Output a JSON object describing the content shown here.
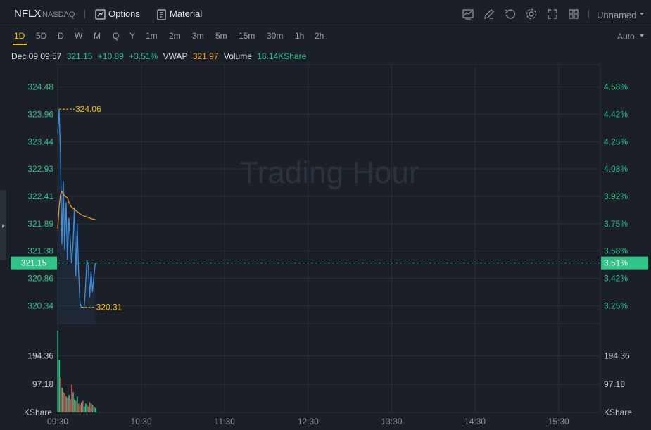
{
  "toolbar": {
    "ticker": "NFLX",
    "exchange": "NASDAQ",
    "options_label": "Options",
    "material_label": "Material",
    "layout_name": "Unnamed",
    "icons": [
      "indicator-icon",
      "draw-icon",
      "undo-icon",
      "settings-icon",
      "fullscreen-icon",
      "layout-grid-icon"
    ]
  },
  "periods": {
    "items": [
      "1D",
      "5D",
      "D",
      "W",
      "M",
      "Q",
      "Y",
      "1m",
      "2m",
      "3m",
      "5m",
      "15m",
      "30m",
      "1h",
      "2h"
    ],
    "active": "1D",
    "scale_mode": "Auto"
  },
  "quote": {
    "datetime": "Dec 09 09:57",
    "price": "321.15",
    "change": "+10.89",
    "change_pct": "+3.51%",
    "vwap_label": "VWAP",
    "vwap": "321.97",
    "volume_label": "Volume",
    "volume": "18.14KShare"
  },
  "colors": {
    "up": "#2fc587",
    "down": "#e0524c",
    "price_line": "#3f8fe0",
    "vwap_line": "#f19e2c",
    "highlight": "#f5c400",
    "watermark": "#2c323c"
  },
  "chart_data": {
    "type": "line",
    "watermark": "Trading Hour",
    "price_ticks": [
      "324.48",
      "323.96",
      "323.44",
      "322.93",
      "322.41",
      "321.89",
      "321.38",
      "320.86",
      "320.34"
    ],
    "pct_ticks": [
      "4.58%",
      "4.42%",
      "4.25%",
      "4.08%",
      "3.92%",
      "3.75%",
      "3.58%",
      "3.42%",
      "3.25%"
    ],
    "current_price_tag": "321.15",
    "current_pct_tag": "3.51%",
    "high_label": "324.06",
    "low_label": "320.31",
    "x_ticks": [
      "09:30",
      "10:30",
      "11:30",
      "12:30",
      "13:30",
      "14:30",
      "15:30"
    ],
    "ylim": [
      320.0,
      324.9
    ],
    "x_range_minutes": [
      0,
      390
    ],
    "series": [
      {
        "name": "price",
        "x": [
          0,
          1,
          2,
          3,
          4,
          5,
          6,
          7,
          8,
          9,
          10,
          11,
          12,
          13,
          14,
          15,
          16,
          17,
          18,
          19,
          20,
          21,
          22,
          23,
          24,
          25,
          26,
          27
        ],
        "values": [
          323.6,
          324.06,
          323.2,
          321.5,
          322.7,
          321.4,
          322.3,
          321.2,
          322.0,
          321.6,
          321.15,
          321.5,
          322.2,
          320.9,
          321.9,
          321.0,
          320.4,
          320.31,
          320.31,
          320.31,
          320.7,
          321.2,
          321.1,
          320.5,
          321.0,
          320.6,
          320.9,
          321.15
        ]
      },
      {
        "name": "VWAP",
        "x": [
          0,
          1,
          2,
          3,
          4,
          5,
          6,
          7,
          8,
          9,
          10,
          11,
          12,
          13,
          14,
          15,
          16,
          17,
          18,
          19,
          20,
          21,
          22,
          23,
          24,
          25,
          26,
          27
        ],
        "values": [
          321.8,
          322.2,
          322.45,
          322.5,
          322.46,
          322.42,
          322.4,
          322.38,
          322.3,
          322.25,
          322.2,
          322.18,
          322.17,
          322.14,
          322.12,
          322.1,
          322.08,
          322.06,
          322.05,
          322.04,
          322.03,
          322.02,
          322.01,
          322.0,
          321.99,
          321.98,
          321.98,
          321.97
        ]
      }
    ],
    "volume_ticks": [
      "194.36",
      "97.18"
    ],
    "volume_unit": "KShare",
    "volume_ylim": [
      0,
      300
    ],
    "volume": {
      "x": [
        0,
        1,
        2,
        3,
        4,
        5,
        6,
        7,
        8,
        9,
        10,
        11,
        12,
        13,
        14,
        15,
        16,
        17,
        18,
        19,
        20,
        21,
        22,
        23,
        24,
        25,
        26,
        27
      ],
      "values": [
        280,
        180,
        120,
        85,
        70,
        65,
        55,
        50,
        60,
        45,
        95,
        70,
        45,
        40,
        55,
        30,
        25,
        35,
        40,
        20,
        30,
        25,
        20,
        35,
        30,
        25,
        20,
        15
      ],
      "direction": [
        "up",
        "up",
        "down",
        "up",
        "down",
        "down",
        "up",
        "down",
        "up",
        "down",
        "down",
        "up",
        "up",
        "down",
        "up",
        "down",
        "down",
        "up",
        "down",
        "up",
        "up",
        "up",
        "down",
        "down",
        "up",
        "down",
        "up",
        "up"
      ]
    }
  }
}
